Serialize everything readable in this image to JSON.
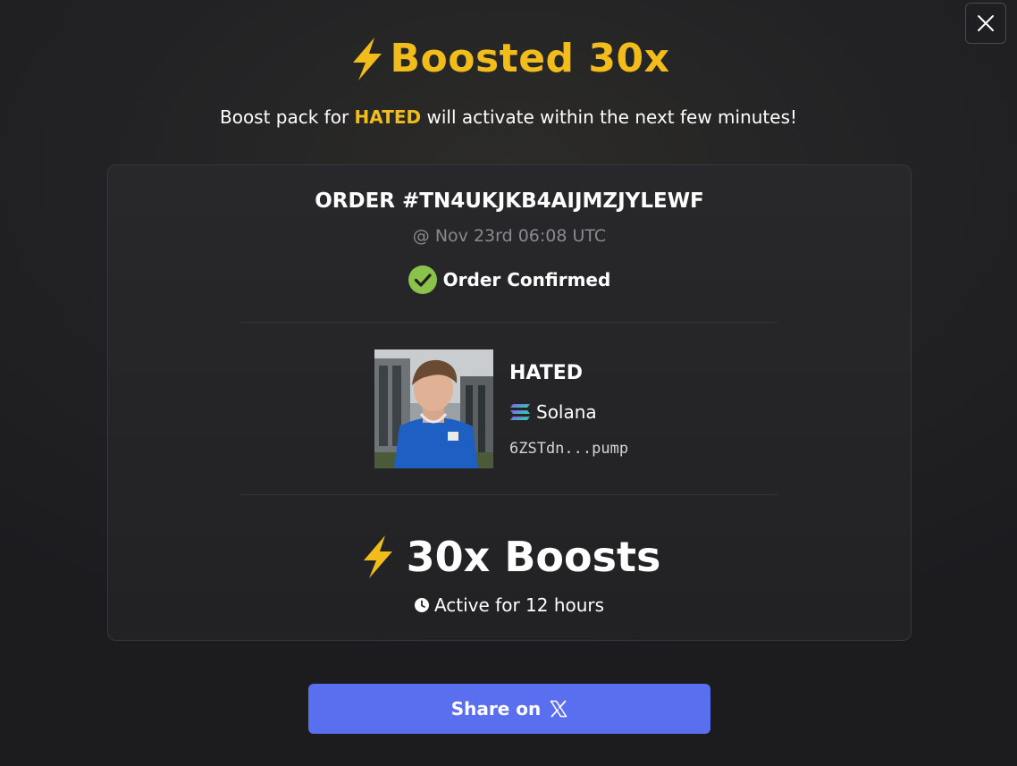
{
  "header": {
    "title": "Boosted 30x",
    "subtitle_prefix": "Boost pack for ",
    "subtitle_token": "HATED",
    "subtitle_suffix": " will activate within the next few minutes!"
  },
  "order": {
    "id": "ORDER #TN4UKJKB4AIJMZJYLEWF",
    "time": "@ Nov 23rd 06:08 UTC",
    "status": "Order Confirmed"
  },
  "token": {
    "name": "HATED",
    "chain": "Solana",
    "address": "6ZSTdn...pump"
  },
  "boost": {
    "label": "30x Boosts",
    "duration": "Active for 12 hours"
  },
  "share": {
    "label": "Share on"
  },
  "icons": {
    "close": "close-icon",
    "bolt": "lightning-bolt-icon",
    "check": "check-circle-icon",
    "solana": "solana-logo-icon",
    "clock": "clock-icon",
    "x": "x-logo-icon"
  },
  "colors": {
    "accent": "#f2bc1b",
    "share_button": "#5a6ff0",
    "confirmed": "#8bc34a"
  }
}
